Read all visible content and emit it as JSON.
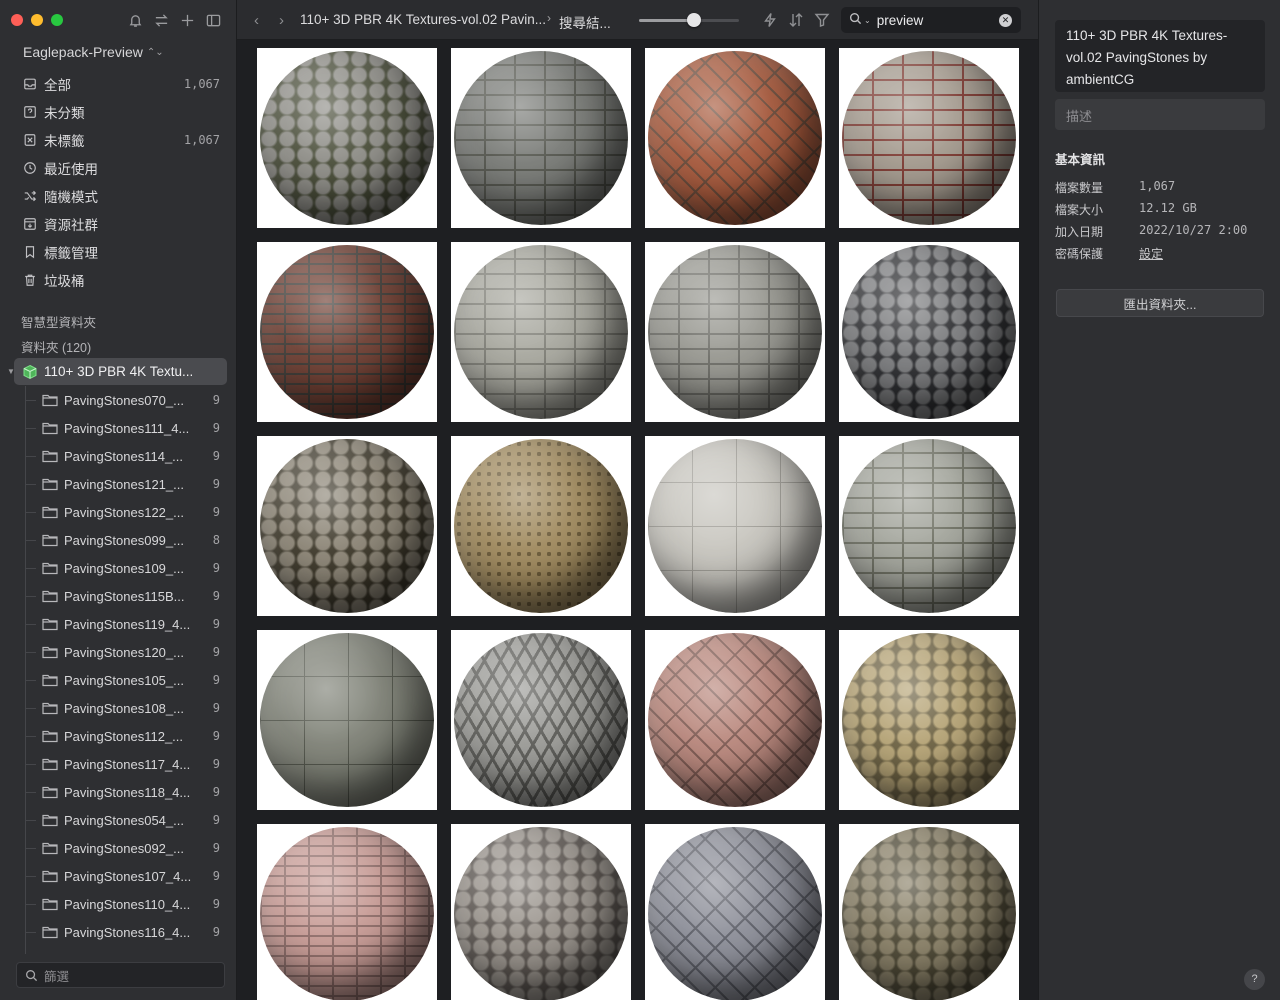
{
  "sidebar": {
    "library_name": "Eaglepack-Preview",
    "nav": [
      {
        "label": "全部",
        "count": "1,067",
        "icon": "inbox-icon"
      },
      {
        "label": "未分類",
        "count": "",
        "icon": "question-icon"
      },
      {
        "label": "未標籤",
        "count": "1,067",
        "icon": "untagged-icon"
      },
      {
        "label": "最近使用",
        "count": "",
        "icon": "clock-icon"
      },
      {
        "label": "隨機模式",
        "count": "",
        "icon": "shuffle-icon"
      },
      {
        "label": "資源社群",
        "count": "",
        "icon": "download-box-icon"
      },
      {
        "label": "標籤管理",
        "count": "",
        "icon": "bookmark-icon"
      },
      {
        "label": "垃圾桶",
        "count": "",
        "icon": "trash-icon"
      }
    ],
    "smart_folders_label": "智慧型資料夾",
    "folders_label": "資料夾 (120)",
    "active_folder": "110+ 3D PBR 4K Textu...",
    "subfolders": [
      {
        "label": "PavingStones070_...",
        "count": "9"
      },
      {
        "label": "PavingStones111_4...",
        "count": "9"
      },
      {
        "label": "PavingStones114_...",
        "count": "9"
      },
      {
        "label": "PavingStones121_...",
        "count": "9"
      },
      {
        "label": "PavingStones122_...",
        "count": "9"
      },
      {
        "label": "PavingStones099_...",
        "count": "8"
      },
      {
        "label": "PavingStones109_...",
        "count": "9"
      },
      {
        "label": "PavingStones115B...",
        "count": "9"
      },
      {
        "label": "PavingStones119_4...",
        "count": "9"
      },
      {
        "label": "PavingStones120_...",
        "count": "9"
      },
      {
        "label": "PavingStones105_...",
        "count": "9"
      },
      {
        "label": "PavingStones108_...",
        "count": "9"
      },
      {
        "label": "PavingStones112_...",
        "count": "9"
      },
      {
        "label": "PavingStones117_4...",
        "count": "9"
      },
      {
        "label": "PavingStones118_4...",
        "count": "9"
      },
      {
        "label": "PavingStones054_...",
        "count": "9"
      },
      {
        "label": "PavingStones092_...",
        "count": "9"
      },
      {
        "label": "PavingStones107_4...",
        "count": "9"
      },
      {
        "label": "PavingStones110_4...",
        "count": "9"
      },
      {
        "label": "PavingStones116_4...",
        "count": "9"
      }
    ],
    "filter_placeholder": "篩選"
  },
  "topbar": {
    "breadcrumb_path": "110+ 3D PBR 4K Textures-vol.02 Pavin...",
    "breadcrumb_separator": "›",
    "breadcrumb_current": "搜尋結...",
    "back_arrow": "‹",
    "forward_arrow": "›",
    "thumbnail_size_fraction": 0.55,
    "search_value": "preview",
    "search_clear": "✕"
  },
  "grid": {
    "columns": 4,
    "tiles": [
      {
        "name": "cobblestone-grey-mossy",
        "base": "#8f8e88",
        "joint": "#4a4e3a",
        "pattern": "cobble"
      },
      {
        "name": "large-grey-slabs",
        "base": "#7a7c78",
        "joint": "#55574f",
        "pattern": "blocks"
      },
      {
        "name": "red-brick-basketweave",
        "base": "#a75a3d",
        "joint": "#6b4b3a",
        "pattern": "herring"
      },
      {
        "name": "mixed-red-grey-stones",
        "base": "#a49a8e",
        "joint": "#7d3a32",
        "pattern": "blocks"
      },
      {
        "name": "dark-red-brick-thin",
        "base": "#6e3f33",
        "joint": "#3f3b36",
        "pattern": "brick"
      },
      {
        "name": "light-interlocking-pavers",
        "base": "#a8a89f",
        "joint": "#7f7f77",
        "pattern": "blocks"
      },
      {
        "name": "light-grey-basketweave",
        "base": "#999992",
        "joint": "#6f6f69",
        "pattern": "blocks"
      },
      {
        "name": "dark-rough-cobblestone",
        "base": "#7c7d7f",
        "joint": "#2f3033",
        "pattern": "cobble"
      },
      {
        "name": "worn-cobble-grid",
        "base": "#8c8576",
        "joint": "#3f3a2c",
        "pattern": "cobble"
      },
      {
        "name": "sandy-studded-pavers",
        "base": "#a08a5e",
        "joint": "#6b5a38",
        "pattern": "dots"
      },
      {
        "name": "smooth-large-slabs",
        "base": "#c8c6bf",
        "joint": "#9f9d96",
        "pattern": "wide"
      },
      {
        "name": "light-grey-small-pavers",
        "base": "#a3a59c",
        "joint": "#6e7063",
        "pattern": "blocks"
      },
      {
        "name": "grey-square-slabs",
        "base": "#7f8277",
        "joint": "#52554b",
        "pattern": "wide"
      },
      {
        "name": "grass-lattice-pavers",
        "base": "#9b9b97",
        "joint": "#5c5c58",
        "pattern": "lattice"
      },
      {
        "name": "pink-brick-herringbone",
        "base": "#b9877c",
        "joint": "#7e5a52",
        "pattern": "herring"
      },
      {
        "name": "yellow-flagstone",
        "base": "#b6a476",
        "joint": "#6e6344",
        "pattern": "cobble"
      },
      {
        "name": "pink-brick-running-bond",
        "base": "#c79b95",
        "joint": "#8f6d69",
        "pattern": "brick"
      },
      {
        "name": "mixed-colour-cobble",
        "base": "#9a948d",
        "joint": "#5d5752",
        "pattern": "cobble"
      },
      {
        "name": "blue-grey-herringbone",
        "base": "#8d8f99",
        "joint": "#5d5f68",
        "pattern": "herring"
      },
      {
        "name": "mossy-granite-cobble",
        "base": "#8a8168",
        "joint": "#4f4a37",
        "pattern": "cobble"
      }
    ]
  },
  "inspector": {
    "title": "110+ 3D PBR 4K Textures-vol.02 PavingStones by ambientCG",
    "description_placeholder": "描述",
    "section_heading": "基本資訊",
    "rows": [
      {
        "key": "檔案數量",
        "value": "1,067"
      },
      {
        "key": "檔案大小",
        "value": "12.12 GB"
      },
      {
        "key": "加入日期",
        "value": "2022/10/27 2:00"
      },
      {
        "key": "密碼保護",
        "value": "設定"
      }
    ],
    "export_button": "匯出資料夾...",
    "help_label": "?"
  }
}
